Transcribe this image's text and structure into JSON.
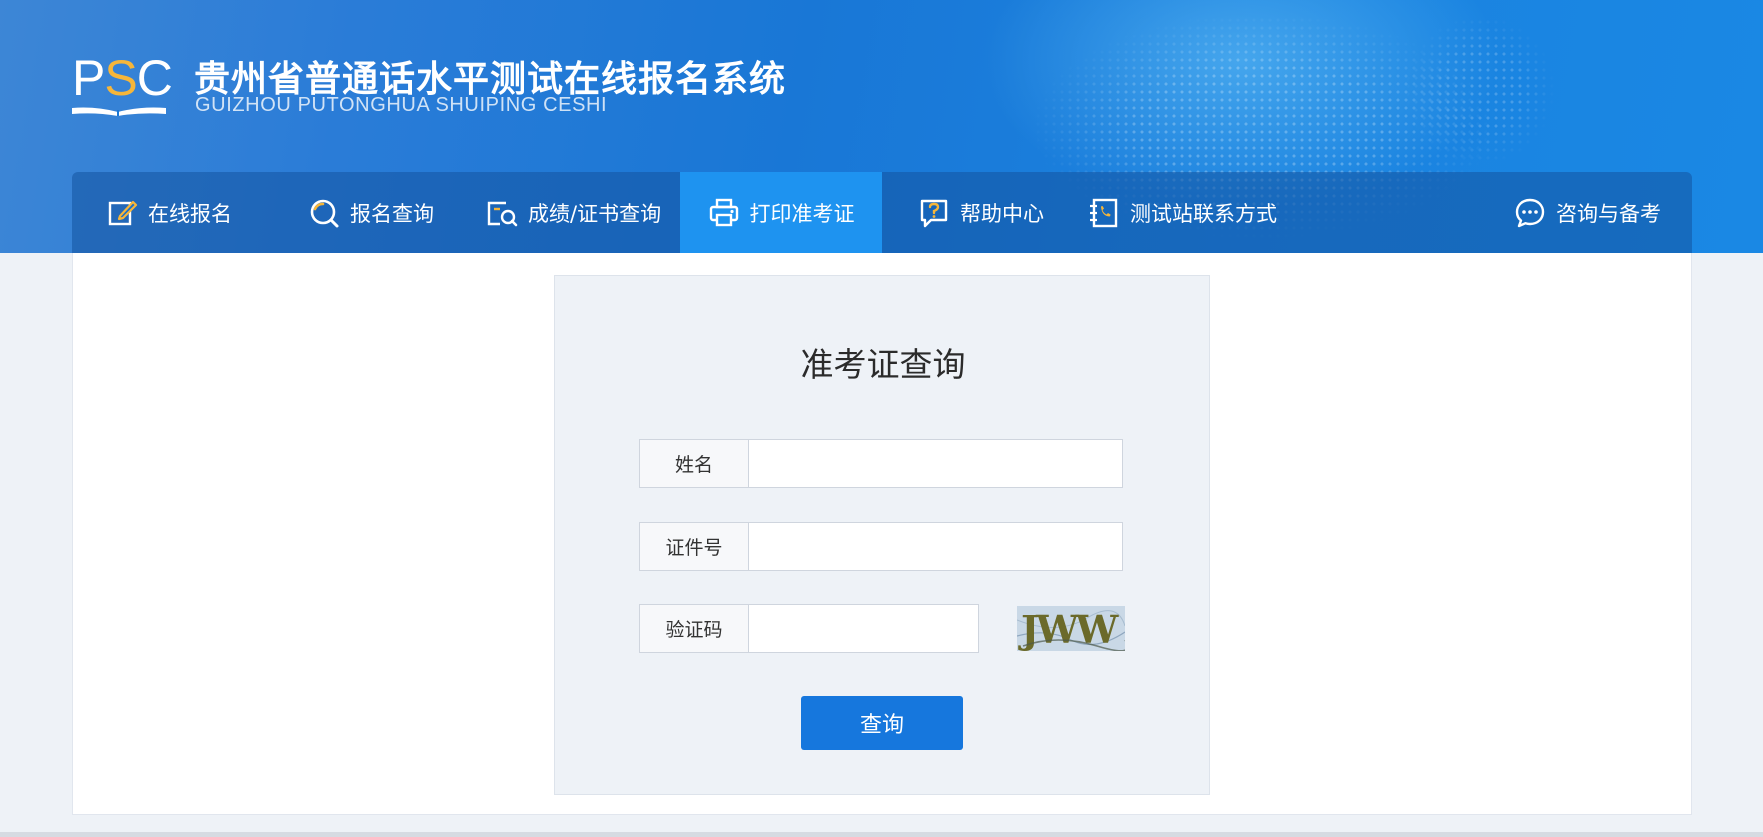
{
  "header": {
    "logo_text_left": "P",
    "logo_text_mid": "S",
    "logo_text_right": "C",
    "title": "贵州省普通话水平测试在线报名系统",
    "subtitle": "GUIZHOU PUTONGHUA SHUIPING CESHI"
  },
  "nav": {
    "items": [
      {
        "label": "在线报名",
        "icon": "edit-icon"
      },
      {
        "label": "报名查询",
        "icon": "search-circle-icon"
      },
      {
        "label": "成绩/证书查询",
        "icon": "certificate-search-icon"
      },
      {
        "label": "打印准考证",
        "icon": "printer-icon",
        "active": true
      },
      {
        "label": "帮助中心",
        "icon": "help-icon"
      },
      {
        "label": "测试站联系方式",
        "icon": "phone-book-icon"
      }
    ],
    "right_item": {
      "label": "咨询与备考",
      "icon": "chat-bubble-icon"
    }
  },
  "form": {
    "title": "准考证查询",
    "name_label": "姓名",
    "name_value": "",
    "id_label": "证件号",
    "id_value": "",
    "captcha_label": "验证码",
    "captcha_value": "",
    "captcha_text": "JWW",
    "submit_label": "查询"
  },
  "colors": {
    "header_blue": "#1977d6",
    "nav_active": "#1e93f0",
    "button_blue": "#1677dd",
    "logo_accent": "#f6b63a"
  }
}
